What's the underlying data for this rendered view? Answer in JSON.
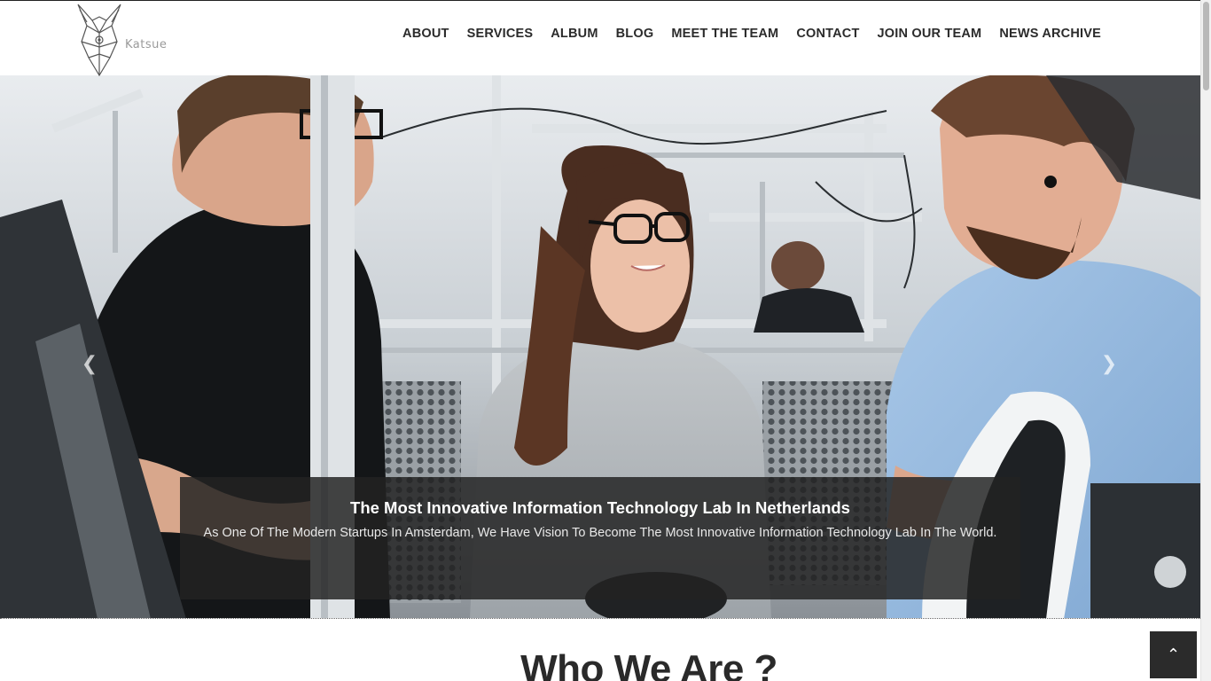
{
  "brand": {
    "name": "Katsue",
    "logo_icon": "fox-head-icon"
  },
  "nav": {
    "items": [
      {
        "label": "ABOUT"
      },
      {
        "label": "SERVICES"
      },
      {
        "label": "ALBUM"
      },
      {
        "label": "BLOG"
      },
      {
        "label": "MEET THE TEAM"
      },
      {
        "label": "CONTACT"
      },
      {
        "label": "JOIN OUR TEAM"
      },
      {
        "label": "NEWS ARCHIVE"
      }
    ]
  },
  "hero": {
    "prev_icon": "chevron-left-icon",
    "next_icon": "chevron-right-icon",
    "caption_title": "The Most Innovative Information Technology Lab In Netherlands",
    "caption_text": "As One Of The Modern Startups In Amsterdam, We Have Vision To Become The Most Innovative Information Technology Lab In The World."
  },
  "about": {
    "title": "Who We Are ?"
  },
  "back_to_top": {
    "icon": "chevron-up-icon"
  },
  "colors": {
    "nav_text": "#2b2b2b",
    "caption_bg": "#232323",
    "button_bg": "#2b2b2b"
  }
}
